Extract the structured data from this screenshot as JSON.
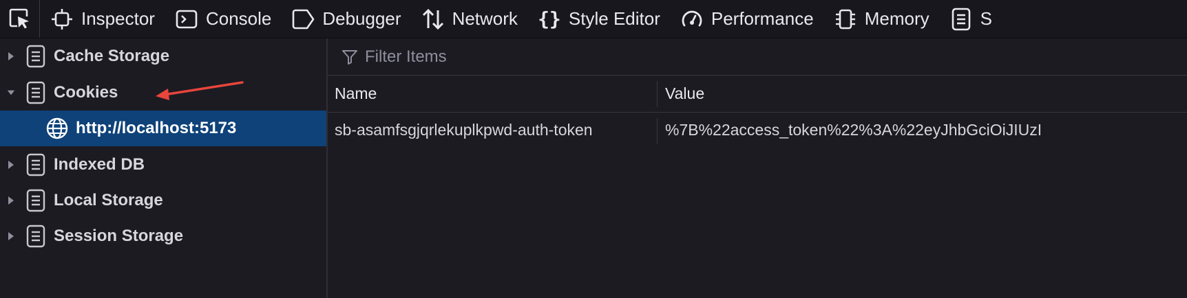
{
  "toolbar": {
    "tabs": [
      {
        "label": "Inspector",
        "icon": "inspector-icon"
      },
      {
        "label": "Console",
        "icon": "console-icon"
      },
      {
        "label": "Debugger",
        "icon": "debugger-icon"
      },
      {
        "label": "Network",
        "icon": "network-icon"
      },
      {
        "label": "Style Editor",
        "icon": "style-editor-icon"
      },
      {
        "label": "Performance",
        "icon": "performance-icon"
      },
      {
        "label": "Memory",
        "icon": "memory-icon"
      },
      {
        "label": "S",
        "icon": "storage-icon"
      }
    ]
  },
  "sidebar": {
    "items": [
      {
        "label": "Cache Storage",
        "expanded": false
      },
      {
        "label": "Cookies",
        "expanded": true
      },
      {
        "label": "http://localhost:5173",
        "selected": true
      },
      {
        "label": "Indexed DB",
        "expanded": false
      },
      {
        "label": "Local Storage",
        "expanded": false
      },
      {
        "label": "Session Storage",
        "expanded": false
      }
    ]
  },
  "filter": {
    "placeholder": "Filter Items"
  },
  "table": {
    "columns": [
      "Name",
      "Value"
    ],
    "rows": [
      {
        "name": "sb-asamfsgjqrlekuplkpwd-auth-token",
        "value": "%7B%22access_token%22%3A%22eyJhbGciOiJIUzI"
      }
    ]
  },
  "colors": {
    "selection": "#0e4279",
    "annotation_arrow": "#e8453c"
  }
}
